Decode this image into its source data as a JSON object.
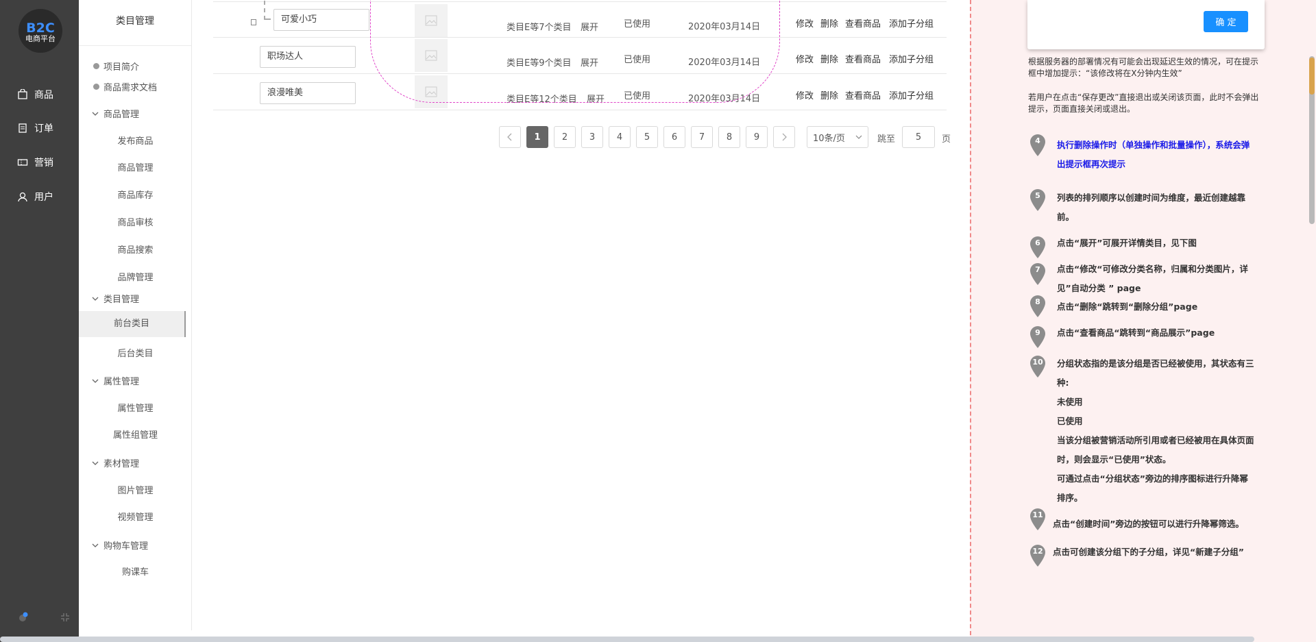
{
  "nav": {
    "logo_main": "B2C",
    "logo_sub": "电商平台",
    "items": [
      {
        "label": "商品"
      },
      {
        "label": "订单"
      },
      {
        "label": "营销"
      },
      {
        "label": "用户"
      }
    ]
  },
  "sidebar": {
    "title": "类目管理",
    "links": [
      {
        "label": "项目简介"
      },
      {
        "label": "商品需求文档"
      }
    ],
    "groups": [
      {
        "label": "商品管理",
        "children": [
          "发布商品",
          "商品管理",
          "商品库存",
          "商品审核",
          "商品搜索",
          "品牌管理"
        ]
      },
      {
        "label": "类目管理",
        "children": [
          "前台类目",
          "后台类目"
        ]
      },
      {
        "label": "属性管理",
        "children": [
          "属性管理",
          "属性组管理"
        ]
      },
      {
        "label": "素材管理",
        "children": [
          "图片管理",
          "视频管理"
        ]
      },
      {
        "label": "购物车管理",
        "children": [
          "购课车"
        ]
      }
    ],
    "active_child": "前台类目"
  },
  "table": {
    "rows": [
      {
        "name": "可爱小巧",
        "sub": "类目E等7个类目",
        "expand": "展开",
        "status": "已使用",
        "date": "2020年03月14日"
      },
      {
        "name": "职场达人",
        "sub": "类目E等9个类目",
        "expand": "展开",
        "status": "已使用",
        "date": "2020年03月14日"
      },
      {
        "name": "浪漫唯美",
        "sub": "类目E等12个类目",
        "expand": "展开",
        "status": "已使用",
        "date": "2020年03月14日"
      }
    ],
    "actions": {
      "edit": "修改",
      "delete": "删除",
      "view": "查看商品",
      "add": "添加子分组"
    }
  },
  "pagination": {
    "pages": [
      "1",
      "2",
      "3",
      "4",
      "5",
      "6",
      "7",
      "8",
      "9"
    ],
    "current": "1",
    "page_size": "10条/页",
    "jump_label": "跳至",
    "jump_value": "5",
    "page_suffix": "页"
  },
  "notes": {
    "dialog_ok": "确 定",
    "p1": "根据服务器的部署情况有可能会出现延迟生效的情况，可在提示框中增加提示：“该修改将在X分钟内生效”",
    "p2": "若用户在点击“保存更改”直接退出或关闭该页面，此时不会弹出提示，页面直接关闭或退出。",
    "items": [
      {
        "num": "4",
        "text": "执行删除操作时（单独操作和批量操作），系统会弹出提示框再次提示"
      },
      {
        "num": "5",
        "text": "列表的排列顺序以创建时间为维度，最近创建越靠前。"
      },
      {
        "num": "6",
        "text": "点击“展开”可展开详情类目，见下图"
      },
      {
        "num": "7",
        "text": "点击“修改“可修改分类名称，归属和分类图片，详见”自动分类 ” page"
      },
      {
        "num": "8",
        "text": "点击“删除“跳转到“删除分组”page"
      },
      {
        "num": "9",
        "text": "点击“查看商品“跳转到“商品展示”page"
      },
      {
        "num": "10",
        "text": "分组状态指的是该分组是否已经被使用，其状态有三种:"
      },
      {
        "num": "11",
        "text": "点击“创建时间”旁边的按钮可以进行升降幂筛选。"
      },
      {
        "num": "12",
        "text": "点击可创建该分组下的子分组，详见“新建子分组”"
      }
    ],
    "status_lines": [
      "未使用",
      "已使用",
      "当该分组被营销活动所引用或者已经被用在具体页面时，则会显示“已使用”状态。",
      "可通过点击“分组状态”旁边的排序图标进行升降幂排序。"
    ]
  },
  "colors": {
    "nav_bg": "#3f3f3f",
    "accent": "#1890ff",
    "annotation_pin": "#8c8c8c",
    "note_blue": "#1a1ae8"
  }
}
